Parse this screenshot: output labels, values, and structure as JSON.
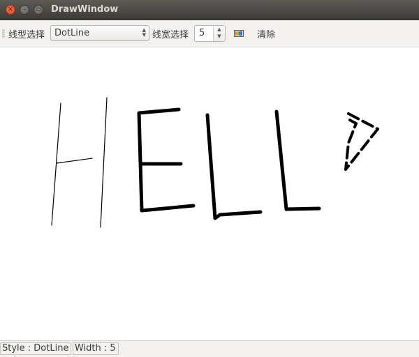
{
  "window": {
    "title": "DrawWindow"
  },
  "toolbar": {
    "line_style_label": "线型选择",
    "line_style_value": "DotLine",
    "line_width_label": "线宽选择",
    "line_width_value": "5",
    "color_icon": "color-palette-icon",
    "clear_label": "清除"
  },
  "canvas": {
    "drawing_text": "HELLO"
  },
  "status": {
    "style": "Style : DotLine",
    "width": "Width : 5"
  }
}
